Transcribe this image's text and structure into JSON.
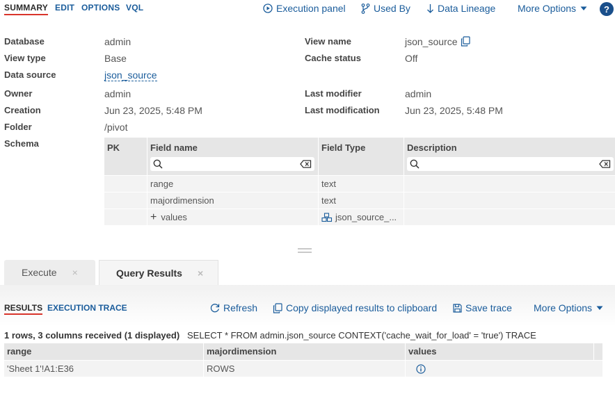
{
  "top_tabs": [
    "SUMMARY",
    "EDIT",
    "OPTIONS",
    "VQL"
  ],
  "top_actions": {
    "execution_panel": "Execution panel",
    "used_by": "Used By",
    "data_lineage": "Data Lineage",
    "more_options": "More Options",
    "help": "?"
  },
  "summary": {
    "database_label": "Database",
    "database": "admin",
    "view_type_label": "View type",
    "view_type": "Base",
    "data_source_label": "Data source",
    "data_source": "json_source",
    "owner_label": "Owner",
    "owner": "admin",
    "creation_label": "Creation",
    "creation": "Jun 23, 2025, 5:48 PM",
    "folder_label": "Folder",
    "folder": "/pivot",
    "schema_label": "Schema",
    "view_name_label": "View name",
    "view_name": "json_source",
    "cache_status_label": "Cache status",
    "cache_status": "Off",
    "last_modifier_label": "Last modifier",
    "last_modifier": "admin",
    "last_modification_label": "Last modification",
    "last_modification": "Jun 23, 2025, 5:48 PM"
  },
  "schema": {
    "headers": [
      "PK",
      "Field name",
      "Field Type",
      "Description"
    ],
    "rows": [
      {
        "pk": "",
        "name": "range",
        "type": "text",
        "desc": ""
      },
      {
        "pk": "",
        "name": "majordimension",
        "type": "text",
        "desc": ""
      },
      {
        "pk": "",
        "name": "values",
        "type": "json_source_...",
        "desc": "",
        "expandable": "+"
      }
    ]
  },
  "bottom_tabs": [
    {
      "label": "Execute",
      "close": "×"
    },
    {
      "label": "Query Results",
      "close": "×"
    }
  ],
  "results": {
    "tabs": [
      "RESULTS",
      "EXECUTION TRACE"
    ],
    "actions": {
      "refresh": "Refresh",
      "copy": "Copy displayed results to clipboard",
      "save_trace": "Save trace",
      "more_options": "More Options"
    },
    "count": "1 rows, 3 columns received (1 displayed)",
    "query": "SELECT * FROM admin.json_source CONTEXT('cache_wait_for_load' = 'true') TRACE",
    "columns": [
      "range",
      "majordimension",
      "values"
    ],
    "rows": [
      {
        "range": "'Sheet 1'!A1:E36",
        "majordimension": "ROWS",
        "values": "info-icon"
      }
    ]
  },
  "colors": {
    "accent": "#1a5c9b",
    "active_underline": "#d9342b",
    "help_bg": "#1a4f8b"
  }
}
